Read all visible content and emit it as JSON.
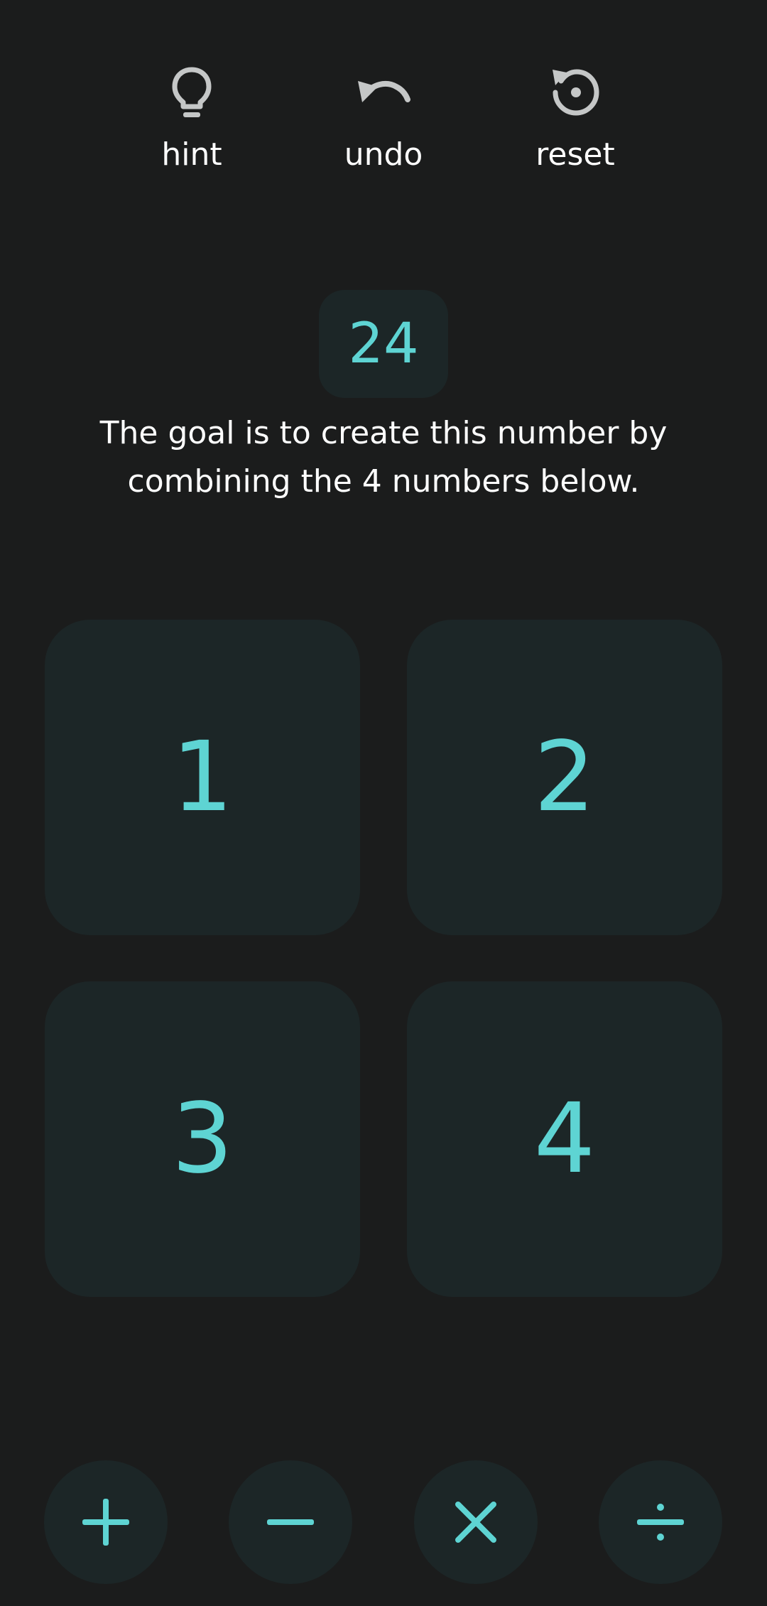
{
  "toolbar": {
    "hint_label": "hint",
    "undo_label": "undo",
    "reset_label": "reset",
    "icon_color": "#c5c7c7"
  },
  "target": {
    "value": "24",
    "description": "The goal is to create this number by combining the 4 numbers below."
  },
  "tiles": [
    {
      "value": "1"
    },
    {
      "value": "2"
    },
    {
      "value": "3"
    },
    {
      "value": "4"
    }
  ],
  "operators": [
    {
      "name": "plus-icon"
    },
    {
      "name": "minus-icon"
    },
    {
      "name": "times-icon"
    },
    {
      "name": "divide-icon"
    }
  ],
  "colors": {
    "background": "#1b1c1c",
    "tile_background": "#1c2627",
    "accent": "#5ed4d3",
    "text": "#ffffff"
  }
}
